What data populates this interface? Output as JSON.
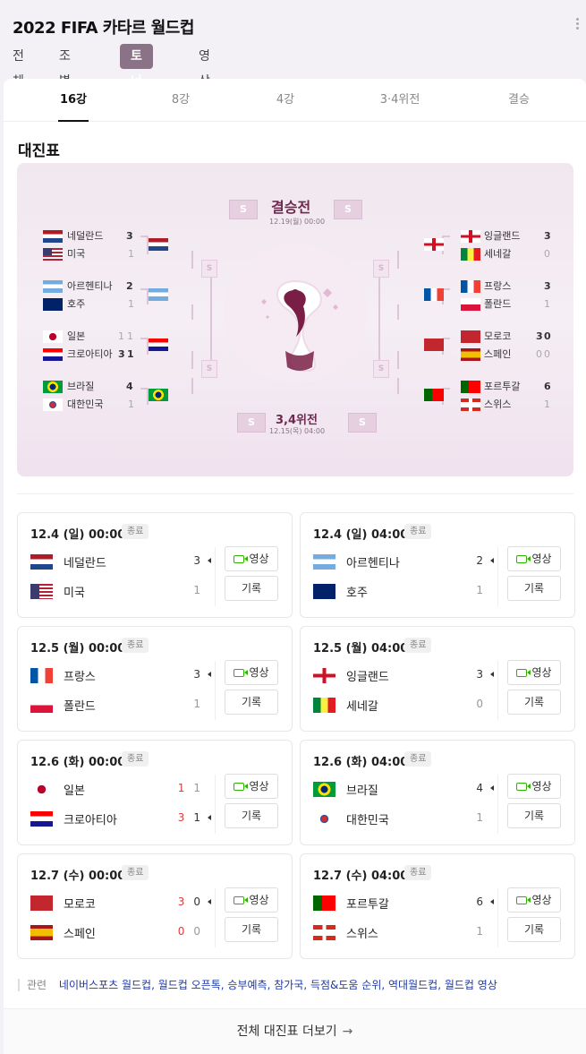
{
  "header": {
    "title": "2022 FIFA 카타르 월드컵",
    "tabs": [
      {
        "label": "전체",
        "active": false
      },
      {
        "label": "조별리그",
        "active": false
      },
      {
        "label": "토너먼트",
        "active": true
      },
      {
        "label": "영상",
        "active": false
      }
    ]
  },
  "round_tabs": [
    {
      "label": "16강",
      "active": true
    },
    {
      "label": "8강",
      "active": false
    },
    {
      "label": "4강",
      "active": false
    },
    {
      "label": "3·4위전",
      "active": false
    },
    {
      "label": "결승",
      "active": false
    }
  ],
  "section_title": "대진표",
  "bracket": {
    "final_label": "결승전",
    "final_date": "12.19(월) 00:00",
    "third_label": "3,4위전",
    "third_date": "12.15(목) 04:00",
    "placeholder": "S",
    "left": [
      {
        "team1": "네덜란드",
        "score1": "3",
        "team2": "미국",
        "score2": "1",
        "pk1": "",
        "pk2": ""
      },
      {
        "team1": "아르헨티나",
        "score1": "2",
        "team2": "호주",
        "score2": "1",
        "pk1": "",
        "pk2": ""
      },
      {
        "team1": "일본",
        "score1": "1",
        "team2": "크로아티아",
        "score2": "1",
        "pk1": "1",
        "pk2": "3"
      },
      {
        "team1": "브라질",
        "score1": "4",
        "team2": "대한민국",
        "score2": "1",
        "pk1": "",
        "pk2": ""
      }
    ],
    "right": [
      {
        "team1": "잉글랜드",
        "score1": "3",
        "team2": "세네갈",
        "score2": "0",
        "pk1": "",
        "pk2": ""
      },
      {
        "team1": "프랑스",
        "score1": "3",
        "team2": "폴란드",
        "score2": "1",
        "pk1": "",
        "pk2": ""
      },
      {
        "team1": "모로코",
        "score1": "0",
        "team2": "스페인",
        "score2": "0",
        "pk1": "3",
        "pk2": "0"
      },
      {
        "team1": "포르투갈",
        "score1": "6",
        "team2": "스위스",
        "score2": "1",
        "pk1": "",
        "pk2": ""
      }
    ]
  },
  "matches": [
    {
      "date": "12.4 (일) 00:00",
      "status": "종료",
      "team1": "네덜란드",
      "flag1": "netherlands-flag",
      "score1": "3",
      "pk1": "",
      "team2": "미국",
      "flag2": "usa-flag",
      "score2": "1",
      "pk2": "",
      "winner": 1
    },
    {
      "date": "12.4 (일) 04:00",
      "status": "종료",
      "team1": "아르헨티나",
      "flag1": "argentina-flag",
      "score1": "2",
      "pk1": "",
      "team2": "호주",
      "flag2": "australia-flag",
      "score2": "1",
      "pk2": "",
      "winner": 1
    },
    {
      "date": "12.5 (월) 00:00",
      "status": "종료",
      "team1": "프랑스",
      "flag1": "france-flag",
      "score1": "3",
      "pk1": "",
      "team2": "폴란드",
      "flag2": "poland-flag",
      "score2": "1",
      "pk2": "",
      "winner": 1
    },
    {
      "date": "12.5 (월) 04:00",
      "status": "종료",
      "team1": "잉글랜드",
      "flag1": "england-flag",
      "score1": "3",
      "pk1": "",
      "team2": "세네갈",
      "flag2": "senegal-flag",
      "score2": "0",
      "pk2": "",
      "winner": 1
    },
    {
      "date": "12.6 (화) 00:00",
      "status": "종료",
      "team1": "일본",
      "flag1": "japan-flag",
      "score1": "1",
      "pk1": "1",
      "team2": "크로아티아",
      "flag2": "croatia-flag",
      "score2": "1",
      "pk2": "3",
      "winner": 2
    },
    {
      "date": "12.6 (화) 04:00",
      "status": "종료",
      "team1": "브라질",
      "flag1": "brazil-flag",
      "score1": "4",
      "pk1": "",
      "team2": "대한민국",
      "flag2": "korea-flag",
      "score2": "1",
      "pk2": "",
      "winner": 1
    },
    {
      "date": "12.7 (수) 00:00",
      "status": "종료",
      "team1": "모로코",
      "flag1": "morocco-flag",
      "score1": "0",
      "pk1": "3",
      "team2": "스페인",
      "flag2": "spain-flag",
      "score2": "0",
      "pk2": "0",
      "winner": 1
    },
    {
      "date": "12.7 (수) 04:00",
      "status": "종료",
      "team1": "포르투갈",
      "flag1": "portugal-flag",
      "score1": "6",
      "pk1": "",
      "team2": "스위스",
      "flag2": "switzerland-flag",
      "score2": "1",
      "pk2": "",
      "winner": 1
    }
  ],
  "buttons": {
    "video": "영상",
    "record": "기록"
  },
  "related": {
    "label": "관련",
    "links": "네이버스포츠 월드컵, 월드컵 오픈톡, 승부예측, 참가국, 득점&도움 순위, 역대월드컵, 월드컵 영상"
  },
  "more_button": {
    "label": "전체 대진표 더보기",
    "arrow": "→"
  }
}
